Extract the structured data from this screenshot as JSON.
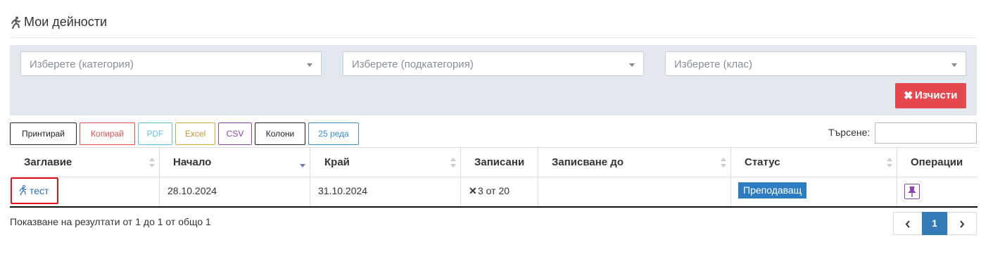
{
  "header": {
    "title": "Мои дейности",
    "icon": "running-person-icon"
  },
  "filters": {
    "category_placeholder": "Изберете (категория)",
    "subcategory_placeholder": "Изберете (подкатегория)",
    "class_placeholder": "Изберете (клас)",
    "clear_label": "Изчисти"
  },
  "toolbar": {
    "print": "Принтирай",
    "copy": "Копирай",
    "pdf": "PDF",
    "excel": "Excel",
    "csv": "CSV",
    "columns": "Колони",
    "rows": "25 реда",
    "search_label": "Търсене:"
  },
  "table": {
    "headers": [
      "Заглавие",
      "Начало",
      "Край",
      "Записани",
      "Записване до",
      "Статус",
      "Операции"
    ],
    "rows": [
      {
        "title": "тест",
        "start": "28.10.2024",
        "end": "31.10.2024",
        "enrolled": "3 от 20",
        "enroll_until": "",
        "status": "Преподаващ"
      }
    ]
  },
  "footer": {
    "info": "Показване на резултати от 1 до 1 от общо 1"
  },
  "pagination": {
    "current": "1"
  },
  "colors": {
    "filter_bg": "#e3e7ee",
    "danger": "#e5484f",
    "primary": "#337ab7",
    "badge": "#2d7cc1",
    "pin": "#8e44ad",
    "highlight": "#e0111b"
  }
}
